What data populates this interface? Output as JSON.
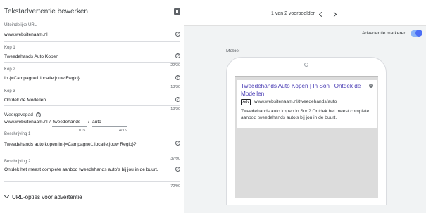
{
  "editor": {
    "title": "Tekstadvertentie bewerken",
    "final_url": {
      "label": "Uiteindelijke URL",
      "value": "www.websitenaam.nl"
    },
    "headline1": {
      "label": "Kop 1",
      "value": "Tweedehands Auto Kopen",
      "count": "22/30"
    },
    "headline2": {
      "label": "Kop 2",
      "value": "In {=Campagne1.locatie:jouw Regio}",
      "count": "13/30"
    },
    "headline3": {
      "label": "Kop 3",
      "value": "Ontdek de Modellen",
      "count": "18/30"
    },
    "display_path": {
      "label": "Weergavepad",
      "base": "www.websitenaam.nl",
      "path1": "tweedehands",
      "path2": "auto",
      "sep": "/",
      "count1": "11/15",
      "count2": "4/15"
    },
    "description1": {
      "label": "Beschrijving 1",
      "value": "Tweedehands auto kopen in {=Campagne1.locatie:jouw Regio}?",
      "count": "37/90"
    },
    "description2": {
      "label": "Beschrijving 2",
      "value": "Ontdek het meest complete aanbod tweedehands auto's bij jou in de buurt.",
      "count": "72/90"
    },
    "url_options": "URL-opties voor advertentie"
  },
  "preview": {
    "pager": "1 van 2 voorbeelden",
    "mark_label": "Advertentie markeren",
    "mark_enabled": true,
    "device_label": "Mobiel",
    "ad": {
      "headline": "Tweedehands Auto Kopen | In Son | Ontdek de Modellen",
      "badge": "Adv",
      "url": "www.websitenaam.nl/tweedehands/auto",
      "description": "Tweedehands auto kopen in Son? Ontdek het meest complete aanbod tweedehands auto's bij jou in de buurt."
    }
  },
  "colors": {
    "accent": "#4c6ef5",
    "headline": "#4a3db4",
    "panel_bg": "#f1f3f4"
  },
  "icons": [
    "edit-icon",
    "help-icon",
    "chevron-left-icon",
    "chevron-right-icon",
    "info-icon",
    "chevron-down-icon"
  ]
}
